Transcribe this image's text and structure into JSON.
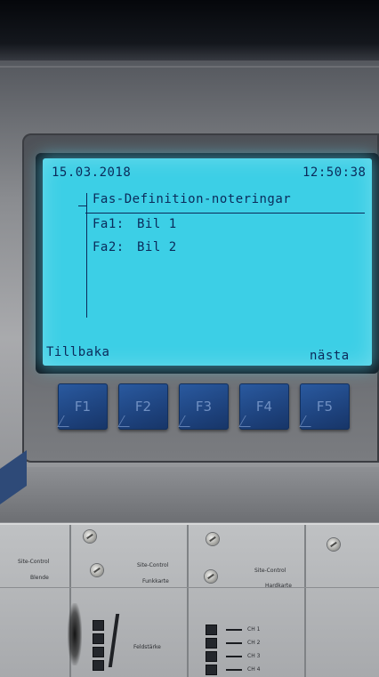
{
  "screen": {
    "date": "15.03.2018",
    "time": "12:50:38",
    "title": "Fas-Definition-noteringar",
    "rows": [
      {
        "label": "Fa1:",
        "value": "Bil 1"
      },
      {
        "label": "Fa2:",
        "value": "Bil 2"
      }
    ],
    "softkey_left": "Tillbaka",
    "softkey_right": "nästa"
  },
  "function_keys": [
    "F1",
    "F2",
    "F3",
    "F4",
    "F5"
  ],
  "rack": {
    "module1_label_line1": "Site-Control",
    "module1_label_line2": "Blende",
    "module2_label_line1": "Site-Control",
    "module2_label_line2": "Funkkarte",
    "module3_label_line1": "Site-Control",
    "module3_label_line2": "Hardkarte",
    "module2_indicator_label": "Feldstärke",
    "channels": [
      "CH 1",
      "CH 2",
      "CH 3",
      "CH 4"
    ]
  },
  "colors": {
    "lcd_background": "#3ccfe6",
    "lcd_text": "#0b2a5a",
    "function_key": "#1c3f78"
  }
}
